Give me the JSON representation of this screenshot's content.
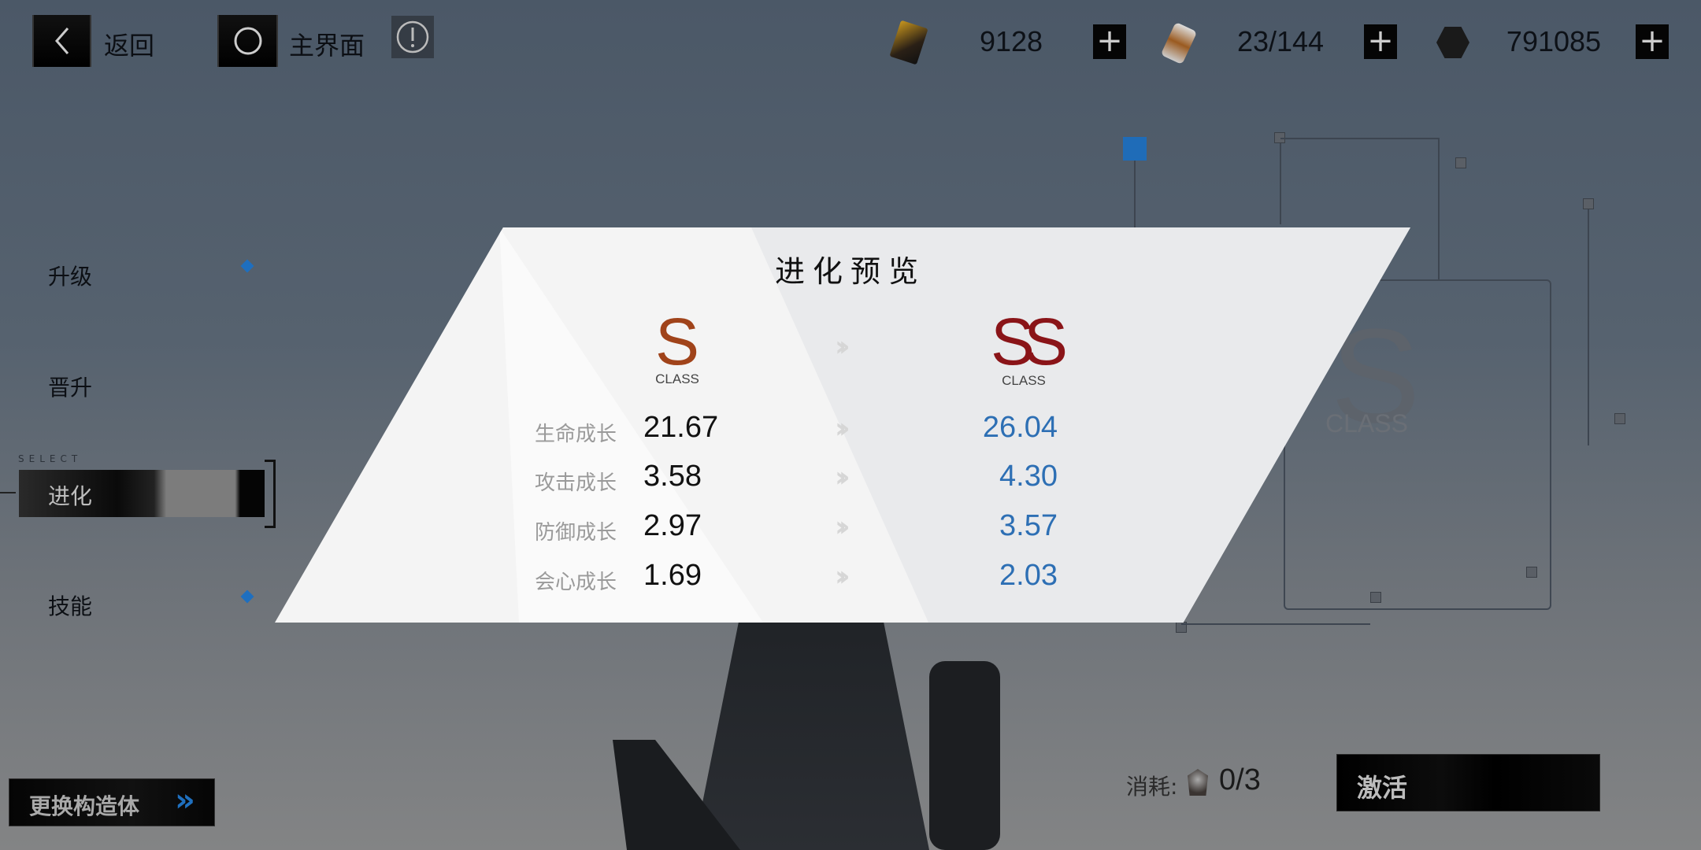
{
  "topbar": {
    "back_label": "返回",
    "home_label": "主界面",
    "icons": {
      "back": "chevron-left-icon",
      "home": "circle-home-icon",
      "info": "exclamation-info-icon"
    }
  },
  "resources": [
    {
      "icon": "gold-card-icon",
      "value": "9128"
    },
    {
      "icon": "energy-canister-icon",
      "value": "23/144"
    },
    {
      "icon": "hex-nut-icon",
      "value": "791085"
    }
  ],
  "sidebar": {
    "select_caption": "SELECT",
    "items": [
      {
        "label": "升级",
        "notify": true
      },
      {
        "label": "晋升",
        "notify": false
      },
      {
        "label": "进化",
        "selected": true
      },
      {
        "label": "技能",
        "notify": true
      }
    ]
  },
  "panel": {
    "title": "进化预览",
    "from_grade": {
      "letter": "S",
      "caption": "CLASS"
    },
    "to_grade": {
      "letter": "SS",
      "caption": "CLASS"
    },
    "arrow": "››",
    "rows": [
      {
        "label": "生命成长",
        "old": "21.67",
        "new": "26.04"
      },
      {
        "label": "攻击成长",
        "old": "3.58",
        "new": "4.30"
      },
      {
        "label": "防御成长",
        "old": "2.97",
        "new": "3.57"
      },
      {
        "label": "会心成长",
        "old": "1.69",
        "new": "2.03"
      }
    ]
  },
  "background": {
    "grade_letter": "S",
    "grade_caption": "CLASS"
  },
  "footer": {
    "switch_label": "更换构造体",
    "switch_arrow": "»",
    "cost_label": "消耗:",
    "cost_value": "0/3",
    "activate_label": "激活"
  },
  "colors": {
    "accent_blue": "#2d6fb4",
    "notify": "#1e6fbf"
  }
}
